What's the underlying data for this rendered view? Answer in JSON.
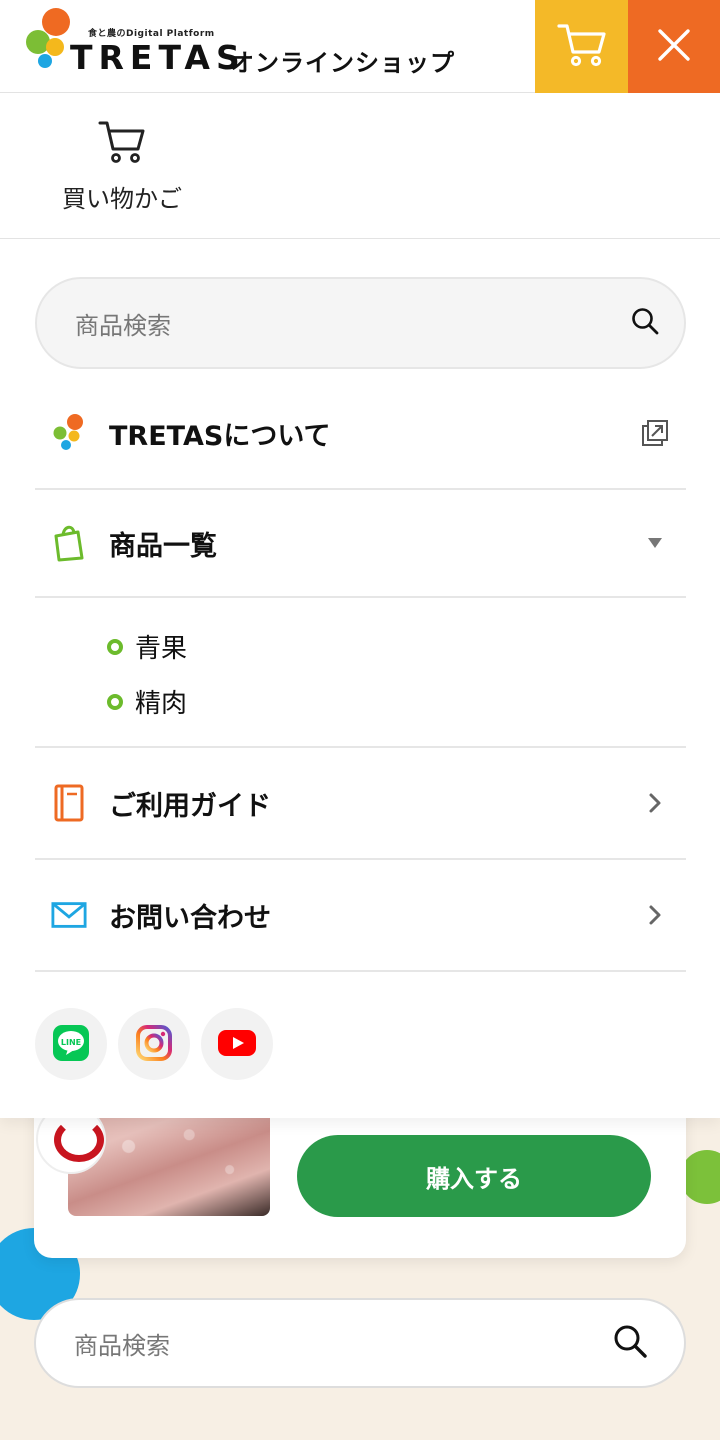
{
  "header": {
    "logo_tagline": "食と農のDigital Platform",
    "logo_name": "TRETAS",
    "logo_sub": "オンラインショップ",
    "colors": {
      "cart_bg": "#f4b928",
      "close_bg": "#ee6a23"
    },
    "cart_icon": "cart-icon",
    "close_icon": "close-icon"
  },
  "menu": {
    "cart_label": "買い物かご",
    "search": {
      "placeholder": "商品検索"
    },
    "items": [
      {
        "label": "TRETASについて",
        "icon": "tretas-dots-icon",
        "trail_icon": "external-link-icon"
      },
      {
        "label": "商品一覧",
        "icon": "shopping-bag-icon",
        "trail_icon": "caret-down-icon",
        "children": [
          {
            "label": "青果"
          },
          {
            "label": "精肉"
          }
        ]
      },
      {
        "label": "ご利用ガイド",
        "icon": "book-icon",
        "trail_icon": "chevron-right-icon"
      },
      {
        "label": "お問い合わせ",
        "icon": "mail-icon",
        "trail_icon": "chevron-right-icon"
      }
    ],
    "sns": [
      {
        "name": "line-icon",
        "label": "LINE",
        "color": "#06c755"
      },
      {
        "name": "instagram-icon",
        "color": "#d62976"
      },
      {
        "name": "youtube-icon",
        "color": "#ff0000"
      }
    ]
  },
  "background_page": {
    "buy_label": "購入する",
    "search": {
      "placeholder": "商品検索"
    },
    "colors": {
      "buy_button": "#2a9a4a",
      "page_bg": "#f7efe4"
    }
  }
}
